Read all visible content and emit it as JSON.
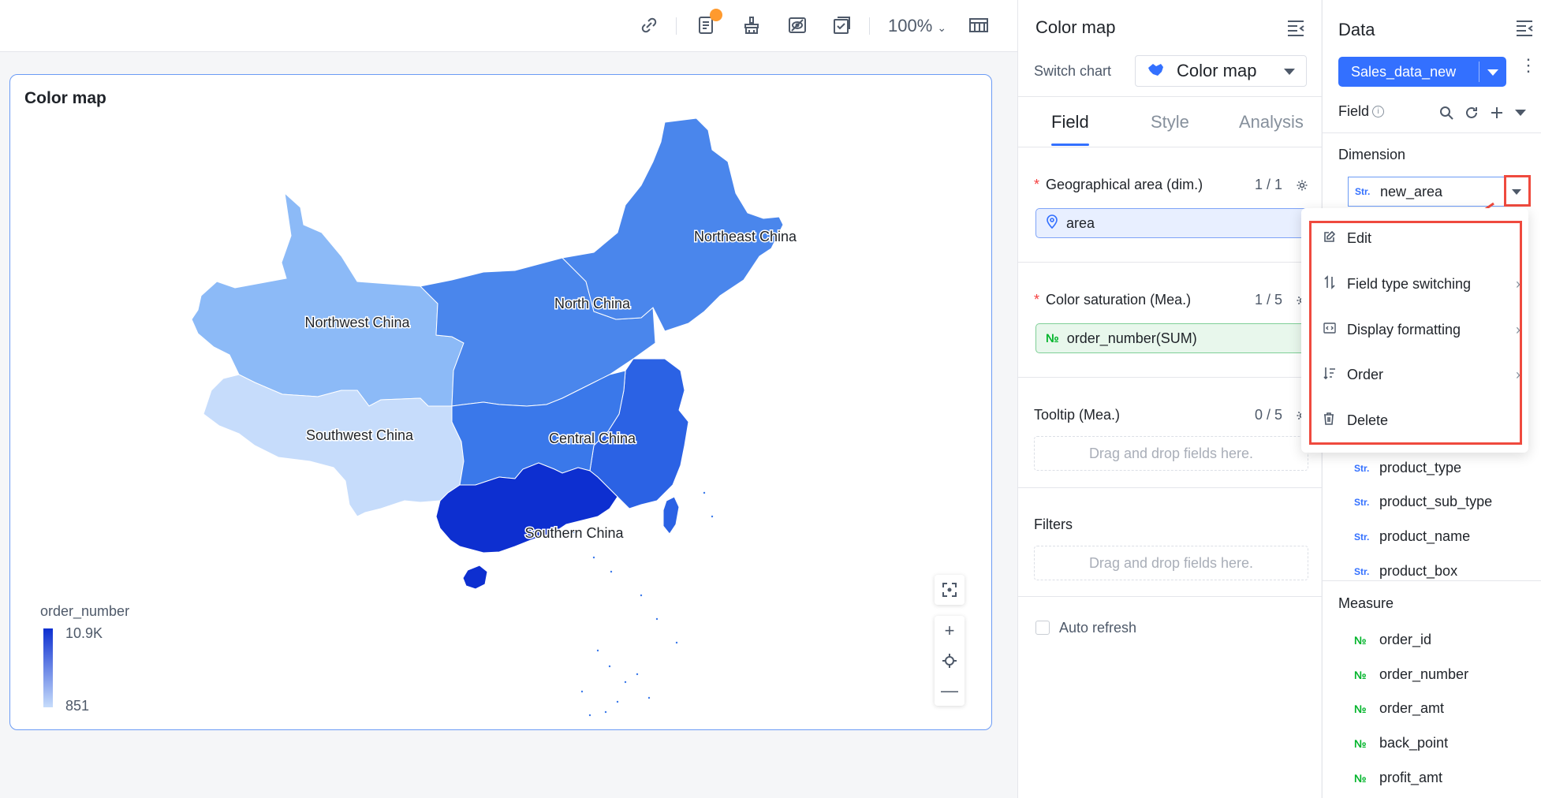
{
  "toolbar": {
    "zoom": "100%",
    "icons": [
      "link-icon",
      "report-icon",
      "brush-icon",
      "preview-icon",
      "check-icon",
      "layout-icon"
    ]
  },
  "canvas": {
    "chart_title": "Color map",
    "legend": {
      "title": "order_number",
      "max": "10.9K",
      "min": "851"
    }
  },
  "chart_data": {
    "type": "map",
    "title": "Color map",
    "measure": "order_number",
    "color_scale": {
      "min": 851,
      "max": 10900,
      "min_color": "#c6dcfb",
      "max_color": "#0d2fd0"
    },
    "regions": [
      {
        "name": "Northwest China",
        "color": "#8cbaf7"
      },
      {
        "name": "Southwest China",
        "color": "#c6dcfb"
      },
      {
        "name": "North China",
        "color": "#4a86ec"
      },
      {
        "name": "Northeast China",
        "color": "#4a86ec"
      },
      {
        "name": "Central China",
        "color": "#3a78ea"
      },
      {
        "name": "Southern China",
        "color": "#0d2fd0"
      }
    ],
    "east_china_color": "#2b62e4"
  },
  "config": {
    "title": "Color map",
    "switch_chart_label": "Switch chart",
    "switch_chart_value": "Color map",
    "tabs": [
      "Field",
      "Style",
      "Analysis"
    ],
    "geo": {
      "label": "Geographical area (dim.)",
      "count": "1 / 1",
      "field": "area"
    },
    "color_sat": {
      "label": "Color saturation (Mea.)",
      "count": "1 / 5",
      "field": "order_number(SUM)"
    },
    "tooltip": {
      "label": "Tooltip (Mea.)",
      "count": "0 / 5",
      "drop": "Drag and drop fields here."
    },
    "filters": {
      "label": "Filters",
      "drop": "Drag and drop fields here."
    },
    "auto_refresh": "Auto refresh"
  },
  "data_panel": {
    "title": "Data",
    "dataset": "Sales_data_new",
    "field_label": "Field",
    "dimension_label": "Dimension",
    "selected_field": "new_area",
    "str_badge": "Str.",
    "num_badge": "№",
    "dimensions": [
      "product_type",
      "product_sub_type",
      "product_name",
      "product_box"
    ],
    "measure_label": "Measure",
    "measures": [
      "order_id",
      "order_number",
      "order_amt",
      "back_point",
      "profit_amt"
    ]
  },
  "context_menu": {
    "items": [
      {
        "label": "Edit",
        "submenu": false
      },
      {
        "label": "Field type switching",
        "submenu": true
      },
      {
        "label": "Display formatting",
        "submenu": true
      },
      {
        "label": "Order",
        "submenu": true
      },
      {
        "label": "Delete",
        "submenu": false
      }
    ]
  },
  "colors": {
    "accent": "#3370ff",
    "highlight": "#ef4a3e"
  }
}
